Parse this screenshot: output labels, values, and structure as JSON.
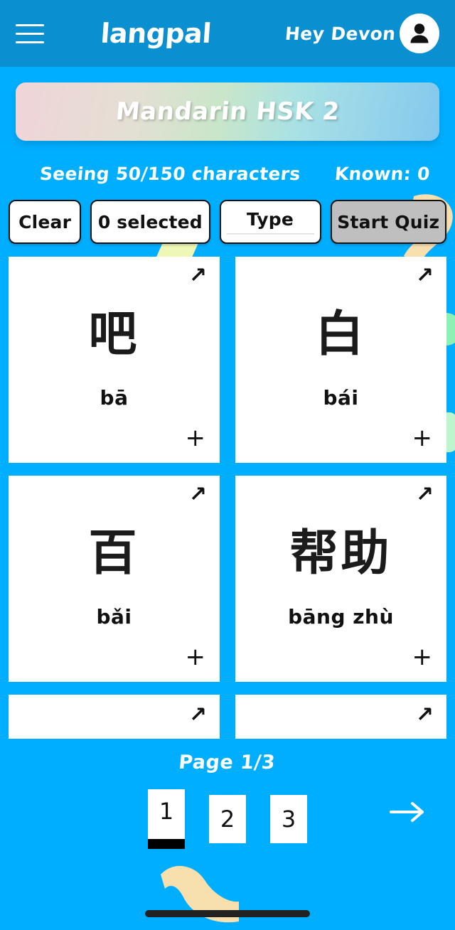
{
  "header": {
    "menu_icon": "hamburger-menu-icon",
    "brand": "langpal",
    "greeting": "Hey Devon",
    "avatar_icon": "user-avatar-icon"
  },
  "banner": {
    "title": "Mandarin HSK 2"
  },
  "stats": {
    "seeing": "Seeing 50/150 characters",
    "known": "Known: 0"
  },
  "toolbar": {
    "clear_label": "Clear",
    "selected_label": "0 selected",
    "type_label": "Type",
    "start_quiz_label": "Start Quiz"
  },
  "cards": [
    {
      "hanzi": "吧",
      "pinyin": "bā",
      "expand_icon": "↗",
      "add_icon": "+"
    },
    {
      "hanzi": "白",
      "pinyin": "bái",
      "expand_icon": "↗",
      "add_icon": "+"
    },
    {
      "hanzi": "百",
      "pinyin": "bǎi",
      "expand_icon": "↗",
      "add_icon": "+"
    },
    {
      "hanzi": "帮助",
      "pinyin": "bāng zhù",
      "expand_icon": "↗",
      "add_icon": "+"
    }
  ],
  "clipped_cards": [
    {
      "expand_icon": "↗"
    },
    {
      "expand_icon": "↗"
    }
  ],
  "pagination": {
    "page_label": "Page 1/3",
    "pages": [
      {
        "number": "1",
        "active": true
      },
      {
        "number": "2",
        "active": false
      },
      {
        "number": "3",
        "active": false
      }
    ],
    "next_icon": "arrow-right-icon"
  },
  "colors": {
    "header_blue": "#0a8fd0",
    "body_blue": "#00aeff",
    "disabled_grey": "#bfbfbf",
    "decor_cream": "#f7dfae",
    "decor_yellow": "#eef7b6",
    "decor_green": "#8df0b4"
  }
}
